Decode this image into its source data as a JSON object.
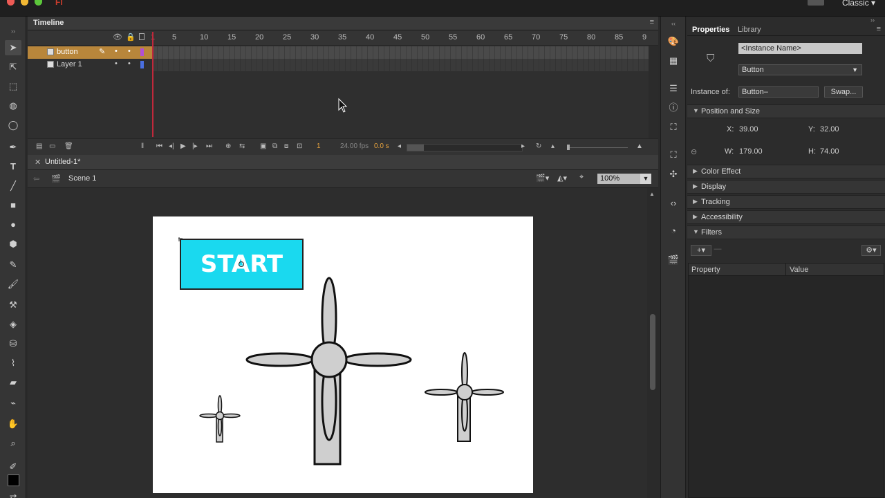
{
  "app": {
    "name": "Fl",
    "workspace": "Classic",
    "colors": {
      "accent_orange": "#e7a33e",
      "button_cyan": "#1ad9ef",
      "playhead": "#c0283b",
      "layer_button_highlight": "#b8863b"
    }
  },
  "timeline": {
    "tab_label": "Timeline",
    "ruler_ticks": [
      "1",
      "5",
      "10",
      "15",
      "20",
      "25",
      "30",
      "35",
      "40",
      "45",
      "50",
      "55",
      "60",
      "65",
      "70",
      "75",
      "80",
      "85",
      "9"
    ],
    "layers": [
      {
        "name": "button",
        "selected": true,
        "color": "#b24fd6"
      },
      {
        "name": "Layer 1",
        "selected": false,
        "color": "#4a6fe0"
      }
    ],
    "controls": {
      "current_frame": "1",
      "fps": "24.00 fps",
      "time": "0.0 s"
    }
  },
  "document": {
    "tab_label": "Untitled-1*",
    "scene_label": "Scene 1",
    "zoom": "100%"
  },
  "stage": {
    "button_text": "START"
  },
  "properties": {
    "tabs": [
      "Properties",
      "Library"
    ],
    "instance_name_placeholder": "<Instance Name>",
    "type_value": "Button",
    "instance_of_label": "Instance of:",
    "instance_of_value": "Button–",
    "swap_label": "Swap...",
    "sections": {
      "position_size": "Position and Size",
      "color_effect": "Color Effect",
      "display": "Display",
      "tracking": "Tracking",
      "accessibility": "Accessibility",
      "filters": "Filters"
    },
    "x_label": "X:",
    "x_value": "39.00",
    "y_label": "Y:",
    "y_value": "32.00",
    "w_label": "W:",
    "w_value": "179.00",
    "h_label": "H:",
    "h_value": "74.00",
    "filter_columns": [
      "Property",
      "Value"
    ]
  }
}
